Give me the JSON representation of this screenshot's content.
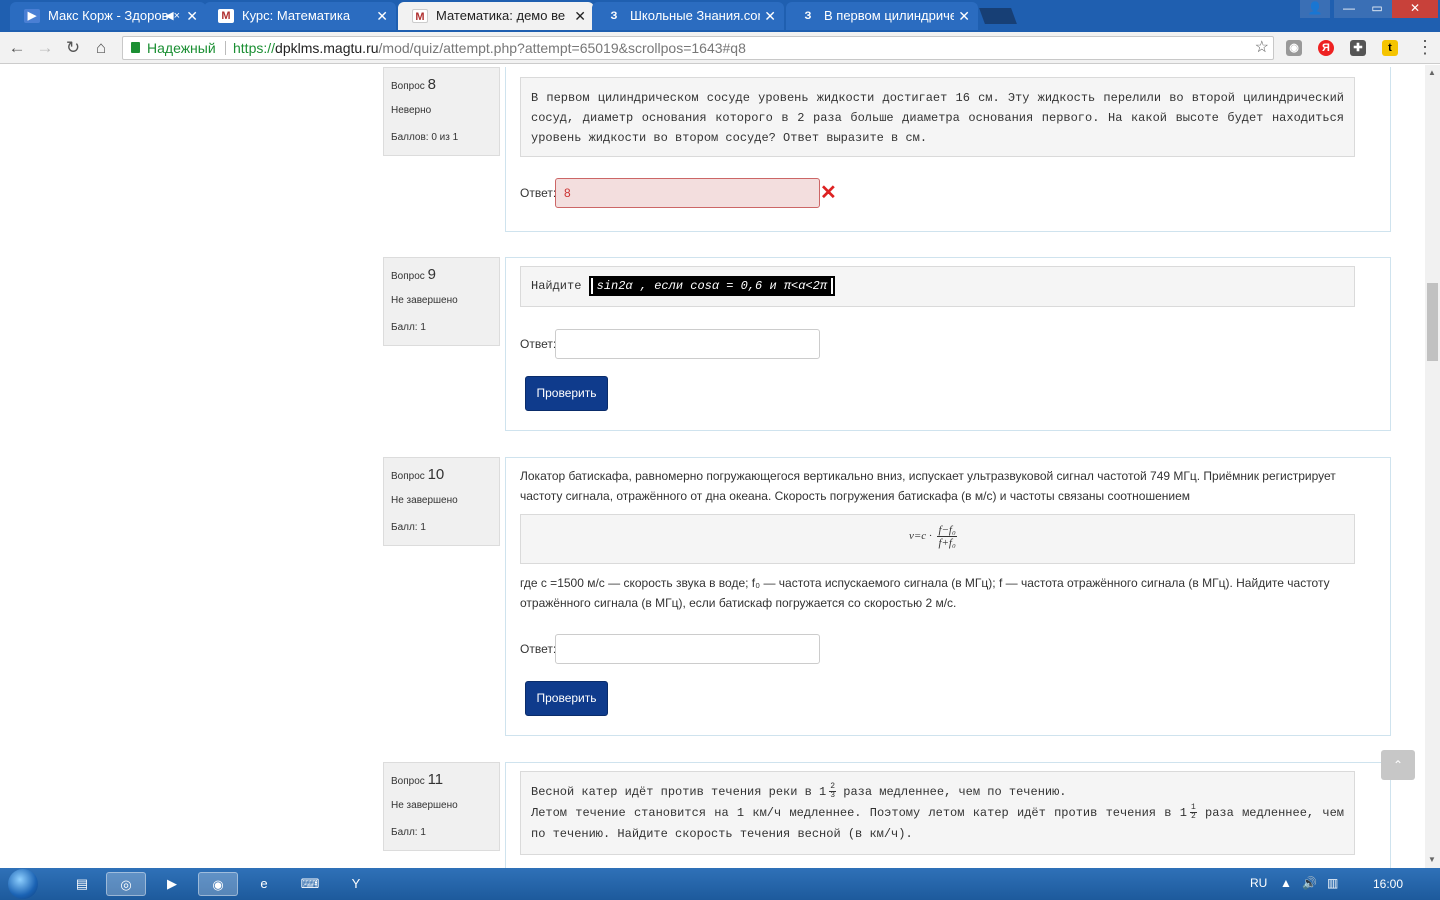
{
  "browser": {
    "tabs": [
      {
        "label": "Макс Корж - Здоров",
        "favicon": "play-icon",
        "favicon_color": "#4a7fd4",
        "audio": true
      },
      {
        "label": "Курс: Математика",
        "favicon": "magtu-icon",
        "favicon_color": "#b03030"
      },
      {
        "label": "Математика: демо верс",
        "favicon": "magtu-icon",
        "favicon_color": "#b03030",
        "active": true
      },
      {
        "label": "Школьные Знания.com",
        "favicon": "z-icon",
        "favicon_color": "#111"
      },
      {
        "label": "В первом цилиндричес",
        "favicon": "z-icon",
        "favicon_color": "#111"
      }
    ],
    "secure_label": "Надежный",
    "url_scheme": "https://",
    "url_host": "dpklms.magtu.ru",
    "url_path": "/mod/quiz/attempt.php?attempt=65019&scrollpos=1643#q8"
  },
  "questions": {
    "q8": {
      "label": "Вопрос",
      "number": "8",
      "state": "Неверно",
      "grade": "Баллов: 0 из 1",
      "text": "В первом цилиндрическом сосуде уровень жидкости достигает 16 см. Эту жидкость перелили во второй цилиндрический сосуд, диаметр основания которого в 2 раза больше диаметра основания первого. На какой высоте будет находиться уровень жидкости во втором сосуде? Ответ выразите в см.",
      "answer_label": "Ответ:",
      "answer_value": "8"
    },
    "q9": {
      "label": "Вопрос",
      "number": "9",
      "state": "Не завершено",
      "grade": "Балл: 1",
      "text_prefix": "Найдите",
      "text_formula": "sin2α , если cosα = 0,6 и π<α<2π",
      "answer_label": "Ответ:",
      "check_label": "Проверить"
    },
    "q10": {
      "label": "Вопрос",
      "number": "10",
      "state": "Не завершено",
      "grade": "Балл: 1",
      "intro": "Локатор батискафа, равномерно погружающегося вертикально вниз, испускает ультразвуковой сигнал частотой 749 МГц. Приёмник регистрирует частоту сигнала, отражённого от дна океана. Скорость погружения батискафа (в м/с) и частоты связаны соотношением",
      "formula_left": "v=c ·",
      "formula_num": "f−f₀",
      "formula_den": "f+f₀",
      "explain": "где c =1500 м/с — скорость звука в воде; f₀ — частота испускаемого сигнала (в МГц); f — частота отражённого сигнала (в МГц). Найдите частоту отражённого сигнала (в МГц), если батискаф погружается со скоростью 2 м/с.",
      "answer_label": "Ответ:",
      "check_label": "Проверить"
    },
    "q11": {
      "label": "Вопрос",
      "number": "11",
      "state": "Не завершено",
      "grade": "Балл: 1",
      "line1_a": "Весной катер идёт против течения реки в 1",
      "line1_num": "2",
      "line1_den": "3",
      "line1_b": " раза медленнее, чем по течению.",
      "line2_a": "Летом течение становится на 1 км/ч медленнее. Поэтому летом катер идёт против течения в 1",
      "line2_num": "1",
      "line2_den": "2",
      "line2_b": " раза медленнее, чем по течению. Найдите скорость течения весной (в км/ч)."
    }
  },
  "taskbar": {
    "lang": "RU",
    "time": "16:00"
  },
  "colors": {
    "check_button": "#0f3b8c",
    "wrong_input": "#f3dede",
    "secure_green": "#1b8f33",
    "tabstrip": "#1f5fb0"
  }
}
